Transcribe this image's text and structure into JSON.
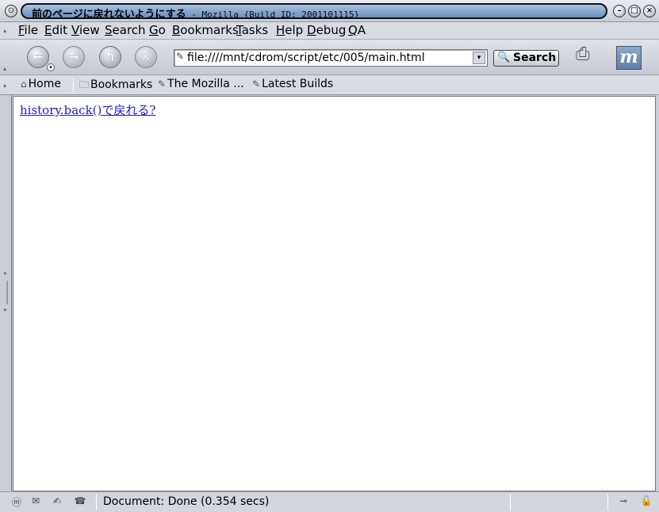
{
  "window": {
    "title_main": "前のページに戻れないようにする",
    "title_sub": " - Mozilla {Build ID: 2001101115}"
  },
  "menu": [
    {
      "label": "File",
      "key": "F",
      "rest": "ile"
    },
    {
      "label": "Edit",
      "key": "E",
      "rest": "dit"
    },
    {
      "label": "View",
      "key": "V",
      "rest": "iew"
    },
    {
      "label": "Search",
      "key": "S",
      "rest": "earch"
    },
    {
      "label": "Go",
      "key": "G",
      "rest": "o"
    },
    {
      "label": "Bookmarks",
      "key": "B",
      "rest": "ookmarks"
    },
    {
      "label": "Tasks",
      "key": "T",
      "rest": "asks"
    },
    {
      "label": "Help",
      "key": "H",
      "rest": "elp"
    },
    {
      "label": "Debug",
      "key": "D",
      "rest": "ebug"
    },
    {
      "label": "QA",
      "key": "Q",
      "rest": "A"
    }
  ],
  "navbar": {
    "url": "file:////mnt/cdrom/script/etc/005/main.html",
    "search_label": "Search"
  },
  "bookmarks": {
    "home": "Home",
    "bookmarks": "Bookmarks",
    "mozilla": "The Mozilla ...",
    "latest": "Latest Builds"
  },
  "page": {
    "link_text": "history.back()で戻れる?"
  },
  "status": {
    "text": "Document: Done (0.354 secs)"
  }
}
